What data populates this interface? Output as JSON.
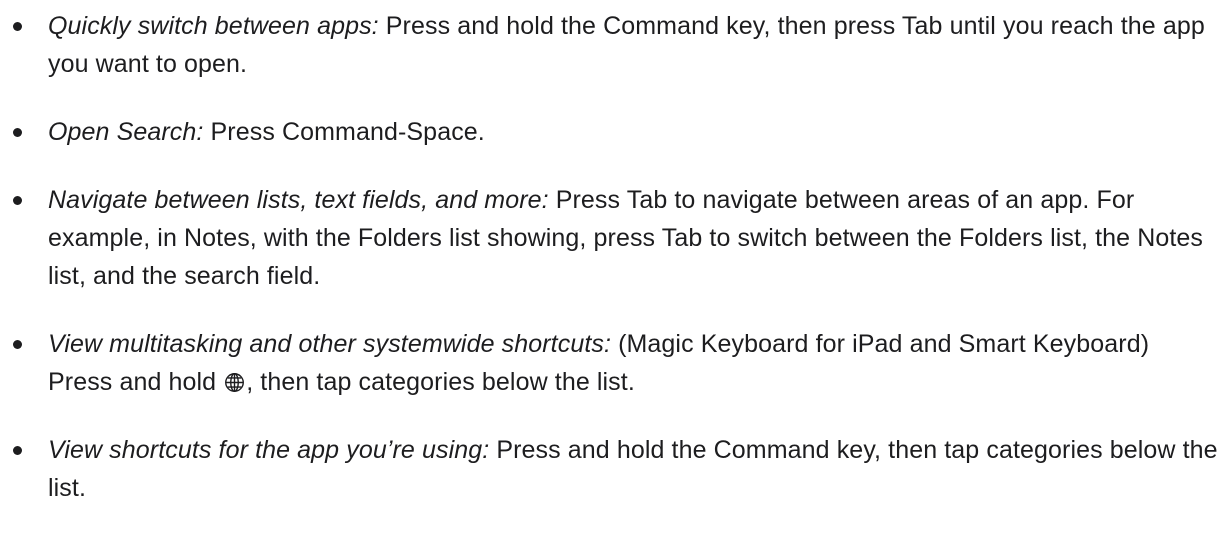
{
  "tips": [
    {
      "title": "Quickly switch between apps:",
      "text": " Press and hold the Command key, then press Tab until you reach the app you want to open."
    },
    {
      "title": "Open Search:",
      "text": " Press Command-Space."
    },
    {
      "title": "Navigate between lists, text fields, and more:",
      "text": " Press Tab to navigate between areas of an app. For example, in Notes, with the Folders list showing, press Tab to switch between the Folders list, the Notes list, and the search field."
    },
    {
      "title": "View multitasking and other systemwide shortcuts:",
      "text_before_icon": " (Magic Keyboard for iPad and Smart Keyboard) Press and hold ",
      "icon": "globe-icon",
      "text_after_icon": ", then tap categories below the list."
    },
    {
      "title": "View shortcuts for the app you’re using:",
      "text": " Press and hold the Command key, then tap categories below the list."
    }
  ],
  "colors": {
    "text": "#1d1d1f",
    "background": "#ffffff"
  }
}
